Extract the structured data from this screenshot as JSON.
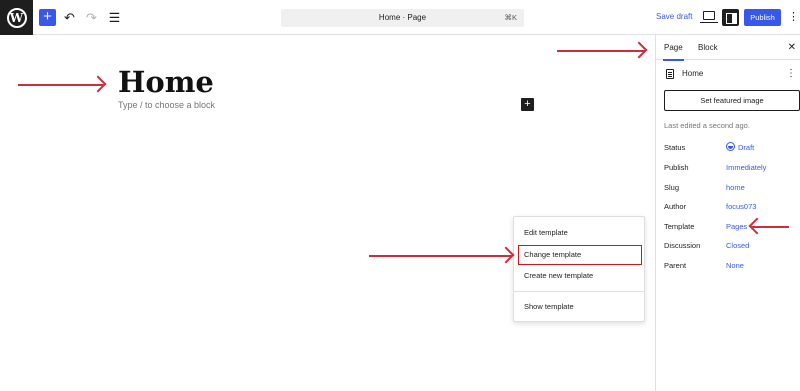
{
  "toolbar": {
    "doc_title": "Home · Page",
    "doc_shortcut": "⌘K",
    "save_draft": "Save draft",
    "publish": "Publish",
    "add_icon": "+",
    "undo_icon": "↶",
    "redo_icon": "↷",
    "list_view_icon": "☰",
    "more_icon": "⋮"
  },
  "canvas": {
    "title": "Home",
    "placeholder": "Type / to choose a block",
    "inserter_icon": "+"
  },
  "template_menu": {
    "items": [
      "Edit template",
      "Change template",
      "Create new template"
    ],
    "extra_item": "Show template",
    "highlighted_index": 1
  },
  "sidebar": {
    "tabs": [
      "Page",
      "Block"
    ],
    "active_tab": "Page",
    "close_icon": "✕",
    "page_name": "Home",
    "more_icon": "⋮",
    "featured_image_button": "Set featured image",
    "last_edited": "Last edited a second ago.",
    "properties": [
      {
        "label": "Status",
        "value": "Draft"
      },
      {
        "label": "Publish",
        "value": "Immediately"
      },
      {
        "label": "Slug",
        "value": "home"
      },
      {
        "label": "Author",
        "value": "focus073"
      },
      {
        "label": "Template",
        "value": "Pages"
      },
      {
        "label": "Discussion",
        "value": "Closed"
      },
      {
        "label": "Parent",
        "value": "None"
      }
    ]
  },
  "colors": {
    "accent": "#3858e9",
    "annotation": "#cc2e3d",
    "dark": "#1e1e1e"
  }
}
